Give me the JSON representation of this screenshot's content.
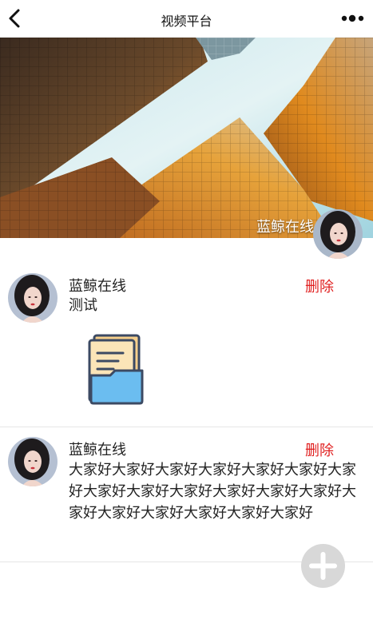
{
  "header": {
    "title": "视频平台"
  },
  "banner": {
    "user_name": "蓝鲸在线"
  },
  "posts": [
    {
      "author": "蓝鲸在线",
      "delete_label": "删除",
      "text": "测试",
      "attachment_icon": "folder-document-icon"
    },
    {
      "author": "蓝鲸在线",
      "delete_label": "删除",
      "text": "大家好大家好大家好大家好大家好大家好大家好大家好大家好大家好大家好大家好大家好大家好大家好大家好大家好大家好大家好"
    }
  ],
  "actions": {
    "add_icon": "plus-icon"
  },
  "colors": {
    "delete_text": "#e02020",
    "fab_background": "#d8d8d8"
  }
}
